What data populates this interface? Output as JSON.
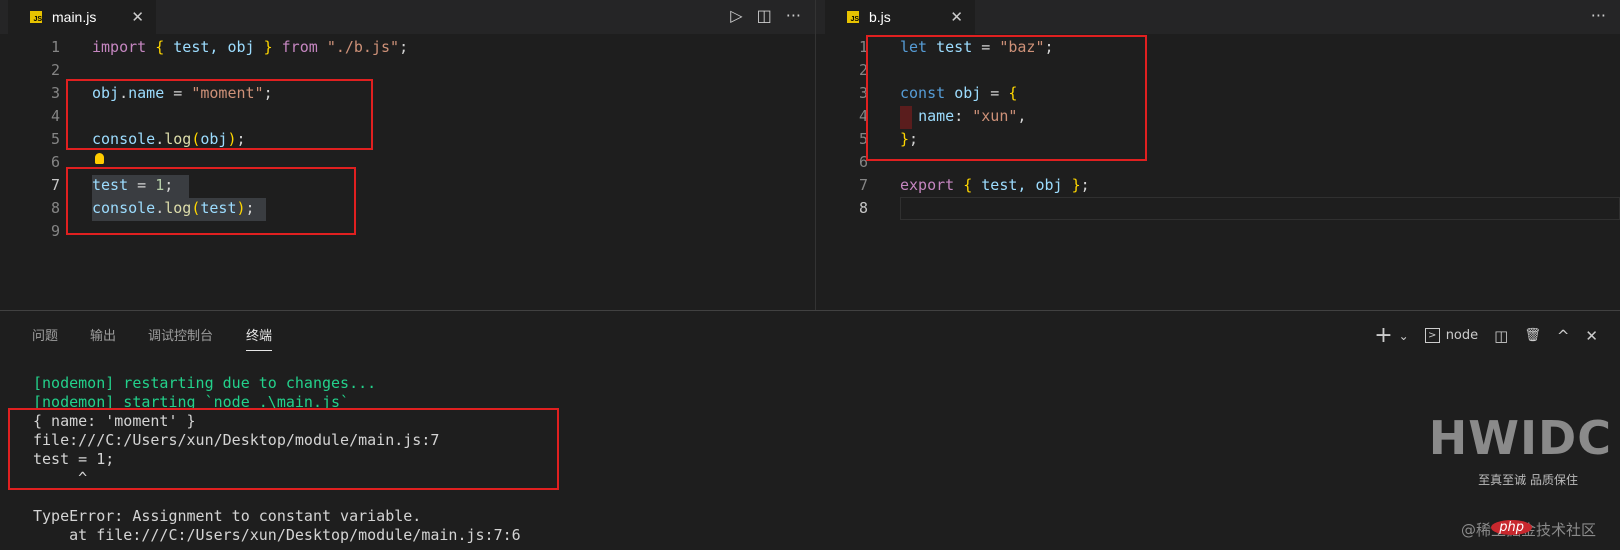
{
  "left_editor": {
    "tab": {
      "label": "main.js",
      "icon": "JS",
      "close": "✕"
    },
    "actions": {
      "run": "▷",
      "split": "◫",
      "more": "···"
    },
    "lines": [
      {
        "n": "1",
        "tokens": [
          [
            "import",
            "kw"
          ],
          [
            " ",
            "pl"
          ],
          [
            "{",
            "br"
          ],
          [
            " test, obj ",
            "var"
          ],
          [
            "}",
            "br"
          ],
          [
            " ",
            "pl"
          ],
          [
            "from",
            "kw"
          ],
          [
            " ",
            "pl"
          ],
          [
            "\"./b.js\"",
            "str"
          ],
          [
            ";",
            "pl"
          ]
        ]
      },
      {
        "n": "2",
        "tokens": []
      },
      {
        "n": "3",
        "tokens": [
          [
            "obj",
            "var"
          ],
          [
            ".",
            "pl"
          ],
          [
            "name",
            "var"
          ],
          [
            " = ",
            "pl"
          ],
          [
            "\"moment\"",
            "str"
          ],
          [
            ";",
            "pl"
          ]
        ]
      },
      {
        "n": "4",
        "tokens": []
      },
      {
        "n": "5",
        "tokens": [
          [
            "console",
            "var"
          ],
          [
            ".",
            "pl"
          ],
          [
            "log",
            "fn"
          ],
          [
            "(",
            "br"
          ],
          [
            "obj",
            "var"
          ],
          [
            ")",
            "br"
          ],
          [
            ";",
            "pl"
          ]
        ]
      },
      {
        "n": "6",
        "tokens": []
      },
      {
        "n": "7",
        "tokens": [
          [
            "test",
            "var"
          ],
          [
            " = ",
            "pl"
          ],
          [
            "1",
            "num"
          ],
          [
            ";",
            "pl"
          ]
        ]
      },
      {
        "n": "8",
        "tokens": [
          [
            "console",
            "var"
          ],
          [
            ".",
            "pl"
          ],
          [
            "log",
            "fn"
          ],
          [
            "(",
            "br"
          ],
          [
            "test",
            "var"
          ],
          [
            ")",
            "br"
          ],
          [
            ";",
            "pl"
          ]
        ]
      },
      {
        "n": "9",
        "tokens": []
      }
    ]
  },
  "right_editor": {
    "tab": {
      "label": "b.js",
      "icon": "JS",
      "close": "✕"
    },
    "actions": {
      "more": "···"
    },
    "lines": [
      {
        "n": "1",
        "tokens": [
          [
            "let",
            "st"
          ],
          [
            " ",
            "pl"
          ],
          [
            "test",
            "var"
          ],
          [
            " = ",
            "pl"
          ],
          [
            "\"baz\"",
            "str"
          ],
          [
            ";",
            "pl"
          ]
        ]
      },
      {
        "n": "2",
        "tokens": []
      },
      {
        "n": "3",
        "tokens": [
          [
            "const",
            "st"
          ],
          [
            " ",
            "pl"
          ],
          [
            "obj",
            "var"
          ],
          [
            " = ",
            "pl"
          ],
          [
            "{",
            "br"
          ]
        ]
      },
      {
        "n": "4",
        "tokens": [
          [
            "  ",
            "pl"
          ],
          [
            "name",
            "var"
          ],
          [
            ": ",
            "pl"
          ],
          [
            "\"xun\"",
            "str"
          ],
          [
            ",",
            "pl"
          ]
        ]
      },
      {
        "n": "5",
        "tokens": [
          [
            "}",
            "br"
          ],
          [
            ";",
            "pl"
          ]
        ]
      },
      {
        "n": "6",
        "tokens": []
      },
      {
        "n": "7",
        "tokens": [
          [
            "export",
            "kw"
          ],
          [
            " ",
            "pl"
          ],
          [
            "{",
            "br"
          ],
          [
            " test, obj ",
            "var"
          ],
          [
            "}",
            "br"
          ],
          [
            ";",
            "pl"
          ]
        ]
      },
      {
        "n": "8",
        "tokens": []
      }
    ]
  },
  "panel": {
    "tabs": [
      "问题",
      "输出",
      "调试控制台",
      "终端"
    ],
    "active_tab": "终端",
    "shell": "node",
    "icons": {
      "add": "+",
      "dropdown": "⌄",
      "split": "◫",
      "trash": "🗑",
      "maximize": "^",
      "close": "✕"
    },
    "terminal_lines": [
      {
        "text": "[nodemon] restarting due to changes...",
        "color": "green"
      },
      {
        "text": "[nodemon] starting `node .\\main.js`",
        "color": "green"
      },
      {
        "text": "{ name: 'moment' }",
        "color": "plain"
      },
      {
        "text": "file:///C:/Users/xun/Desktop/module/main.js:7",
        "color": "plain"
      },
      {
        "text": "test = 1;",
        "color": "plain"
      },
      {
        "text": "     ^",
        "color": "plain"
      },
      {
        "text": "",
        "color": "plain"
      },
      {
        "text": "TypeError: Assignment to constant variable.",
        "color": "plain"
      },
      {
        "text": "    at file:///C:/Users/xun/Desktop/module/main.js:7:6",
        "color": "plain"
      }
    ]
  },
  "watermark": {
    "brand": "HWIDC",
    "slogan": "至真至诚 品质保住",
    "credit": "@稀土掘金技术社区",
    "badge": "php"
  }
}
